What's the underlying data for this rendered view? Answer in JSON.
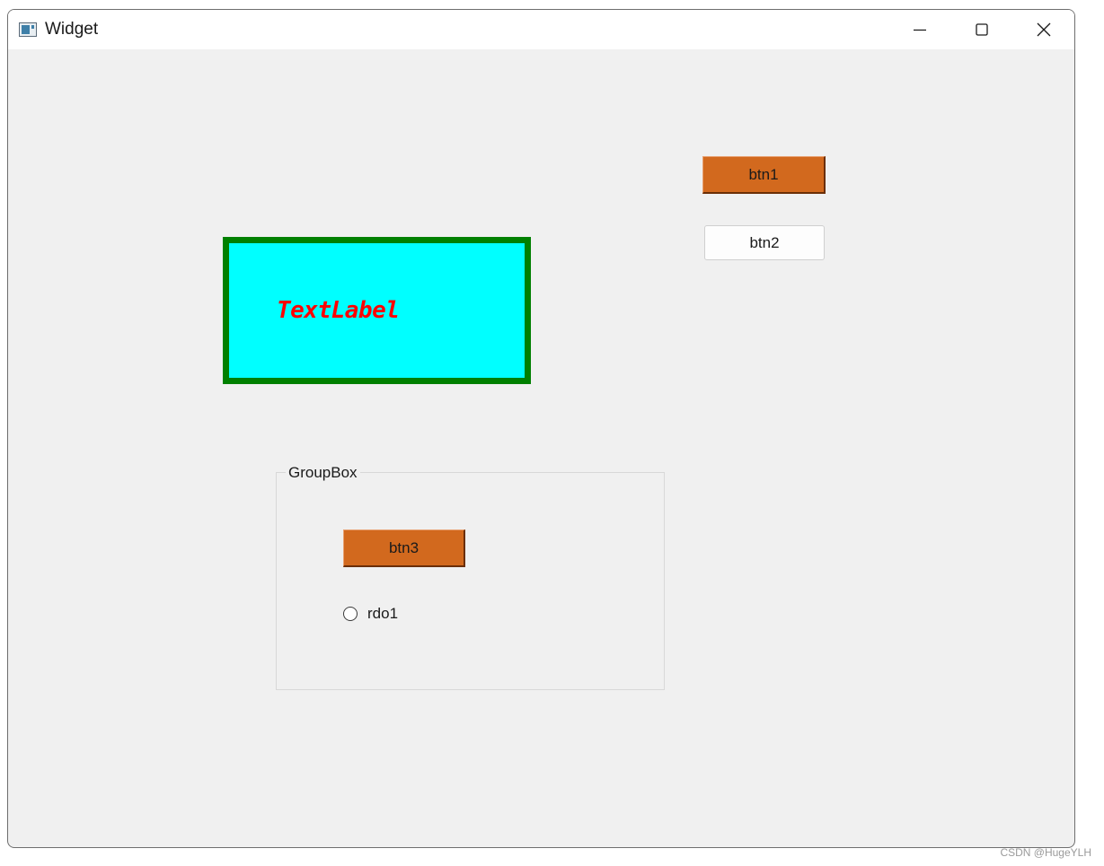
{
  "window": {
    "title": "Widget",
    "controls": {
      "minimize": "minimize-icon",
      "maximize": "maximize-icon",
      "close": "close-icon"
    }
  },
  "buttons": {
    "btn1": "btn1",
    "btn2": "btn2",
    "btn3": "btn3"
  },
  "label": {
    "text": "TextLabel",
    "background": "#00ffff",
    "border": "#008000",
    "color": "#ff0000"
  },
  "groupbox": {
    "title": "GroupBox",
    "radio": {
      "label": "rdo1",
      "checked": false
    }
  },
  "colors": {
    "accent_button": "#d2691e",
    "window_bg": "#f0f0f0"
  },
  "watermark": "CSDN @HugeYLH"
}
